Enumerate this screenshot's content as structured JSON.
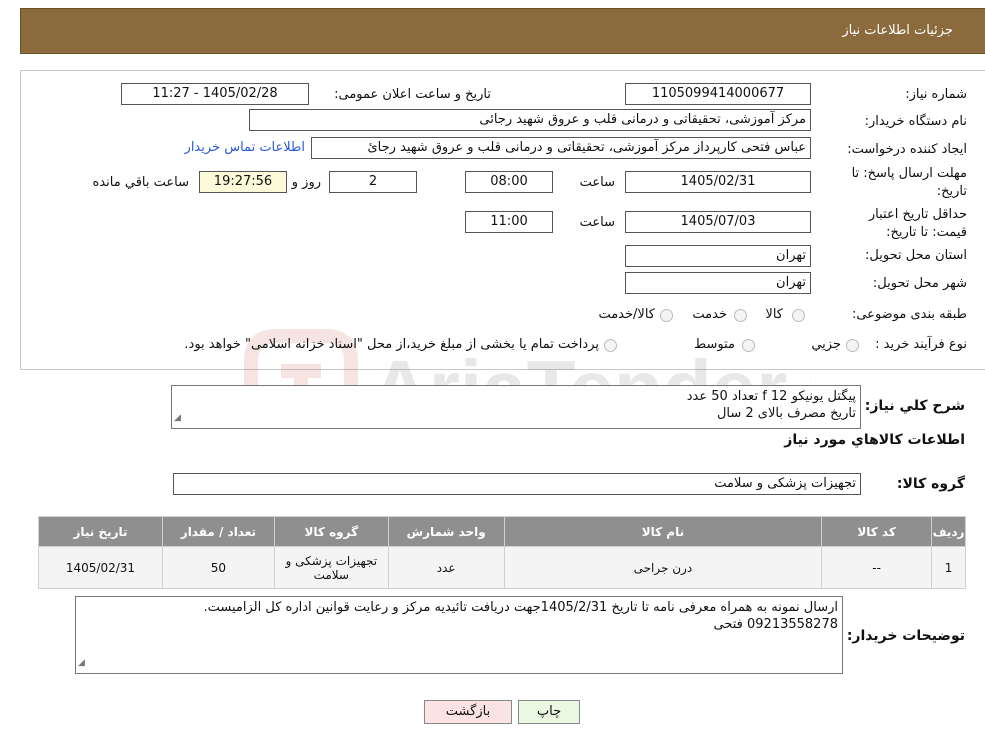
{
  "header": {
    "title": "جزئیات اطلاعات نیاز"
  },
  "form": {
    "need_number_label": "شماره نیاز:",
    "need_number": "1105099414000677",
    "announce_label": "تاریخ و ساعت اعلان عمومی:",
    "announce_value": "1405/02/28 - 11:27",
    "buyer_org_label": "نام دستگاه خریدار:",
    "buyer_org": "مرکز آموزشی، تحقیقاتی و درمانی قلب و عروق شهید رجائی",
    "creator_label": "ایجاد کننده درخواست:",
    "creator": "عباس فتحی کارپرداز مرکز آموزشی، تحقیقاتی و درمانی قلب و عروق شهید رجائ",
    "contact_link": "اطلاعات تماس خریدار",
    "deadline_label": "مهلت ارسال پاسخ: تا تاریخ:",
    "deadline_date": "1405/02/31",
    "time_word": "ساعت",
    "deadline_time": "08:00",
    "days_value": "2",
    "days_word": "روز و",
    "remaining_time": "19:27:56",
    "remaining_word": "ساعت باقي مانده",
    "validity_label": "حداقل تاریخ اعتبار قیمت: تا تاریخ:",
    "validity_date": "1405/07/03",
    "validity_time": "11:00",
    "province_label": "استان محل تحویل:",
    "province": "تهران",
    "city_label": "شهر محل تحویل:",
    "city": "تهران",
    "category_label": "طبقه بندی موضوعی:",
    "category_options": [
      "کالا",
      "خدمت",
      "کالا/خدمت"
    ],
    "process_label": "نوع فرآیند خرید :",
    "process_options": [
      "جزیي",
      "متوسط"
    ],
    "process_note": "پرداخت تمام یا بخشی از مبلغ خرید،از محل \"اسناد خزانه اسلامی\" خواهد بود."
  },
  "description": {
    "label": "شرح کلي نياز:",
    "line1": "پیگتل یونیکو f 12     تعداد 50 عدد",
    "line2": "تاریخ مصرف بالای 2 سال"
  },
  "goods_info": {
    "title": "اطلاعات کالاهاي مورد نياز",
    "group_label": "گروه کالا:",
    "group_value": "تجهیزات پزشکی و سلامت"
  },
  "table": {
    "headers": [
      "رديف",
      "کد کالا",
      "نام کالا",
      "واحد شمارش",
      "گروه کالا",
      "تعداد / مقدار",
      "تاریخ نیاز"
    ],
    "rows": [
      [
        "1",
        "--",
        "درن جراحی",
        "عدد",
        "تجهیزات پزشکی و سلامت",
        "50",
        "1405/02/31"
      ]
    ]
  },
  "buyer_notes": {
    "label": "توضیحات خریدار:",
    "line1": "ارسال نمونه به همراه معرفی نامه تا تاریخ 1405/2/31جهت دریافت تائیدیه مرکز و رعایت قوانین اداره کل الزامیست.",
    "line2": "09213558278 فتحی"
  },
  "buttons": {
    "print": "چاپ",
    "back": "بازگشت"
  },
  "watermark": {
    "text": "AriaTender.neT"
  },
  "colors": {
    "header_bg": "#8b6a3e",
    "table_header_bg": "#8f8f8f",
    "link": "#2a5bd7",
    "yellow_box": "#fcfbd9"
  }
}
